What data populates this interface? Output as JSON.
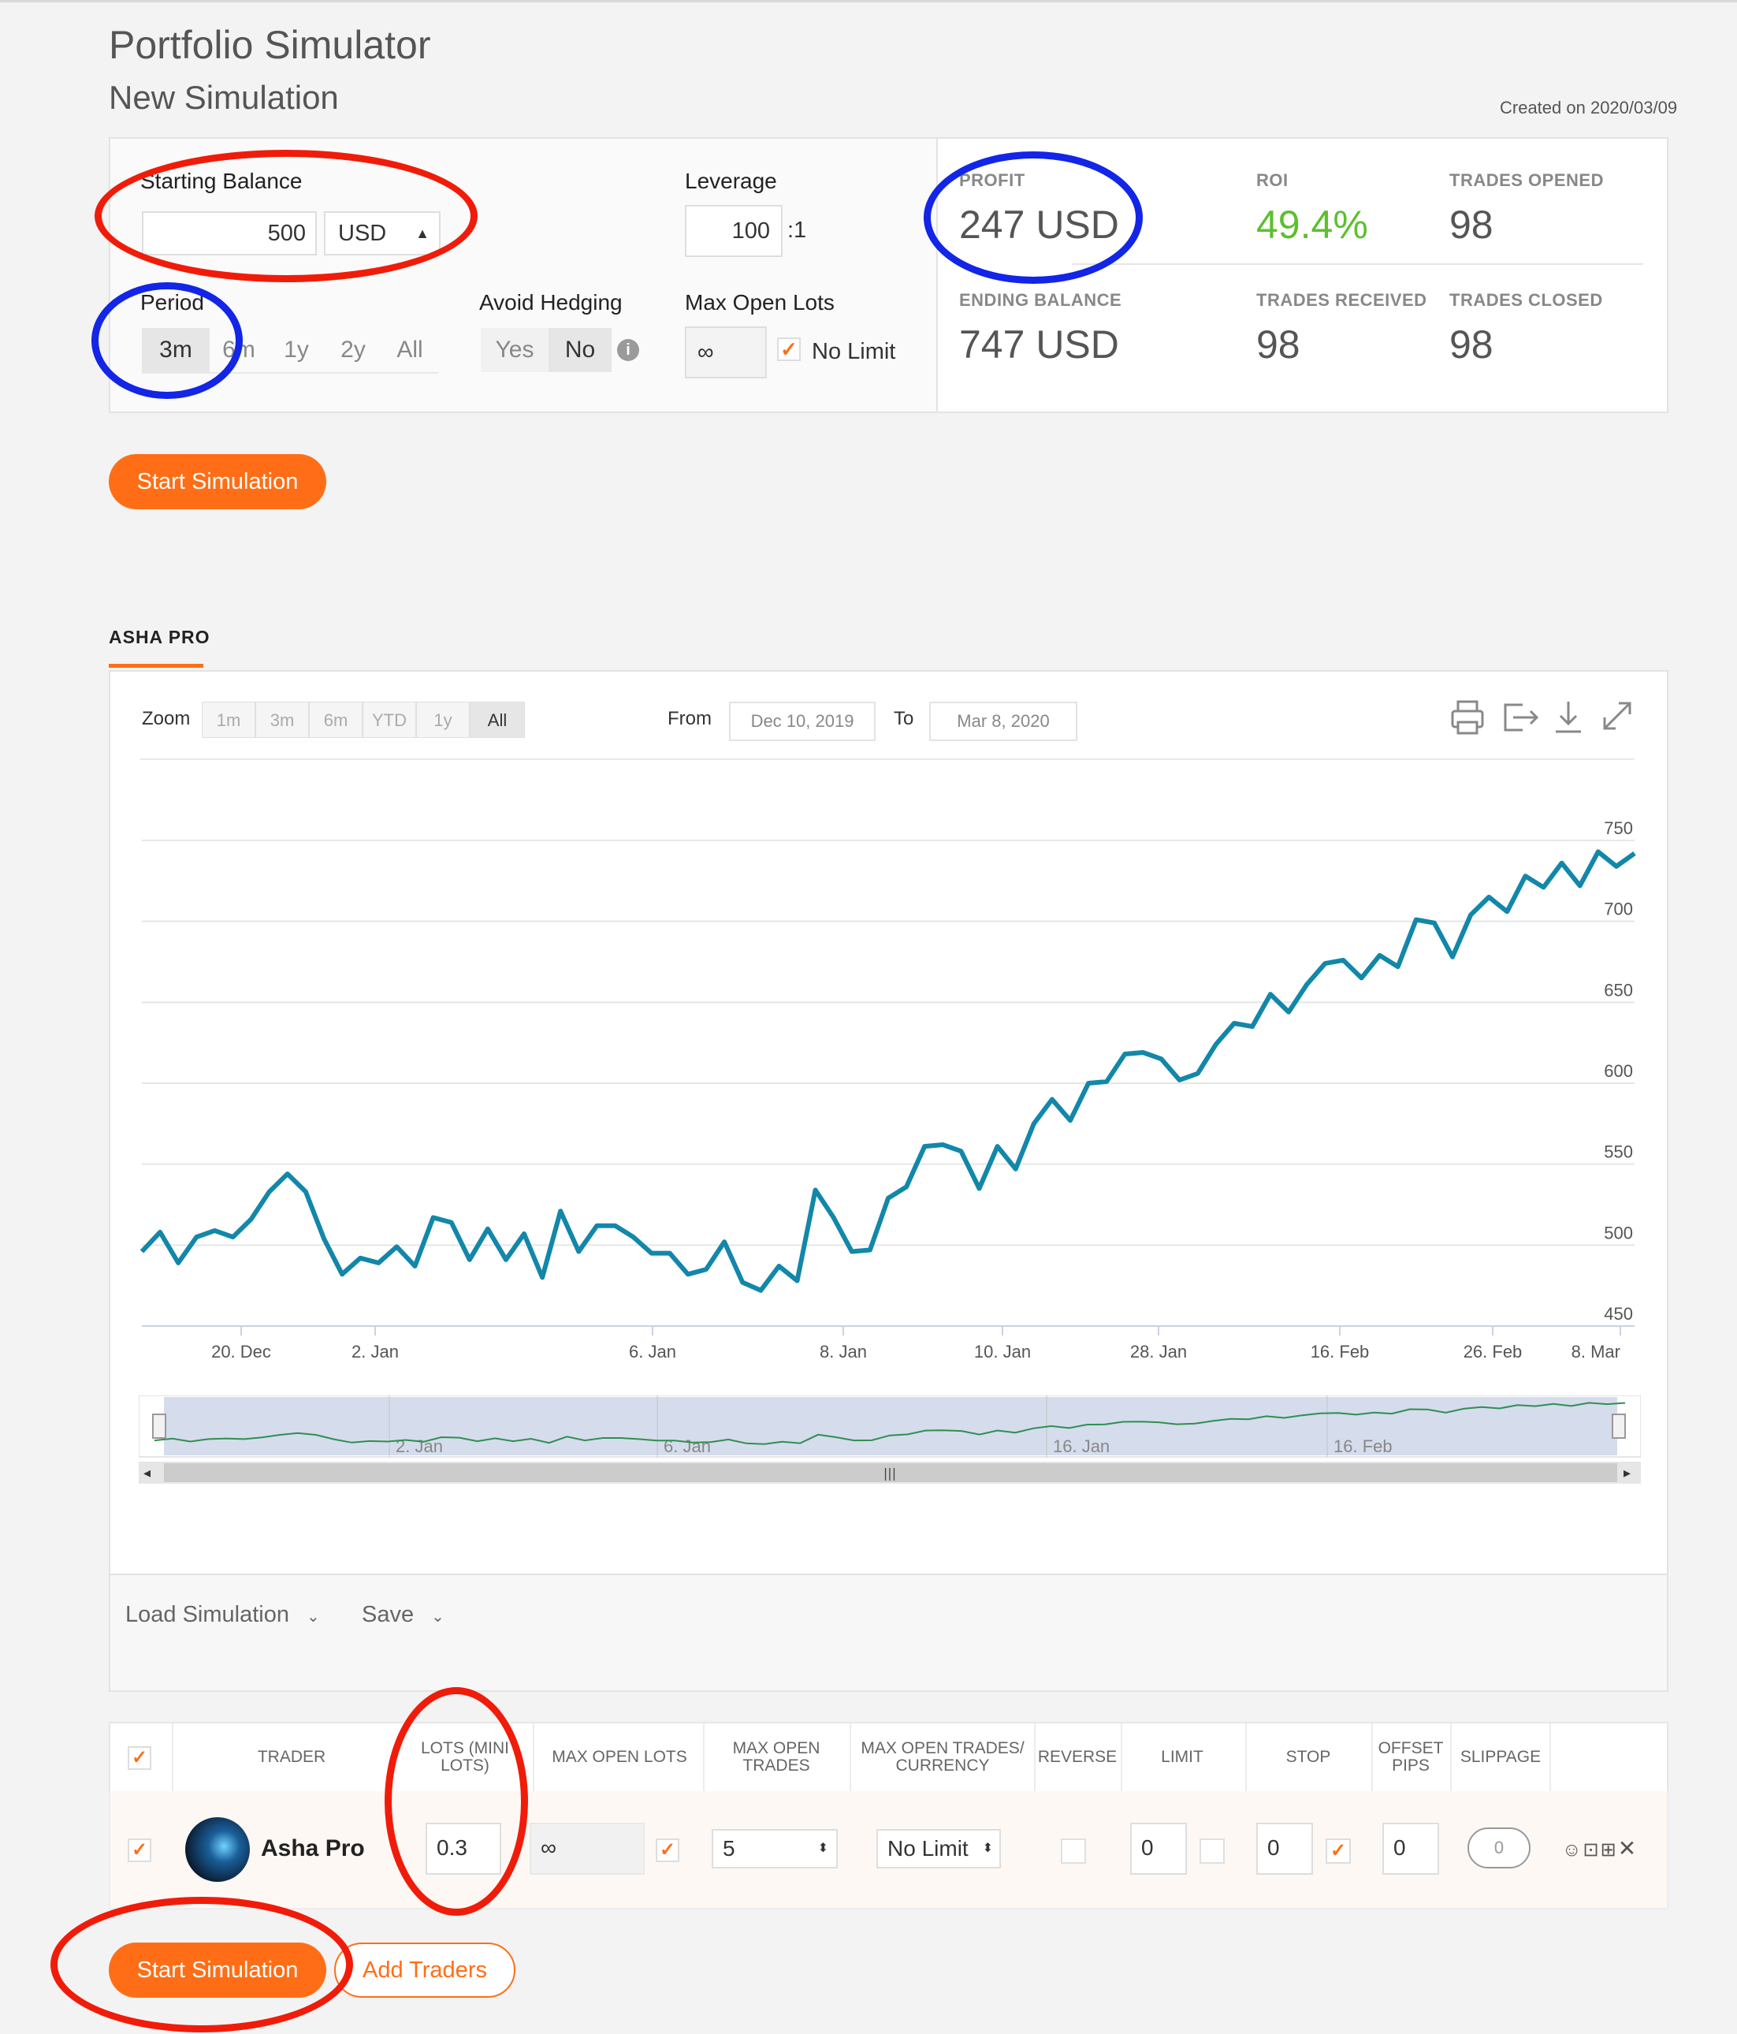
{
  "header": {
    "title": "Portfolio Simulator",
    "subtitle": "New Simulation",
    "created": "Created on 2020/03/09"
  },
  "settings": {
    "starting_balance_label": "Starting Balance",
    "starting_balance_value": "500",
    "currency": "USD",
    "leverage_label": "Leverage",
    "leverage_value": "100",
    "leverage_suffix": ":1",
    "period_label": "Period",
    "period_options": [
      "3m",
      "6m",
      "1y",
      "2y",
      "All"
    ],
    "period_selected": "3m",
    "avoid_hedging_label": "Avoid Hedging",
    "avoid_hedging_options": [
      "Yes",
      "No"
    ],
    "avoid_hedging_selected": "No",
    "max_open_lots_label": "Max Open Lots",
    "max_open_lots_value": "∞",
    "no_limit_label": "No Limit"
  },
  "stats": {
    "profit_label": "PROFIT",
    "profit_value": "247 USD",
    "roi_label": "ROI",
    "roi_value": "49.4%",
    "trades_opened_label": "TRADES OPENED",
    "trades_opened_value": "98",
    "ending_balance_label": "ENDING BALANCE",
    "ending_balance_value": "747 USD",
    "trades_received_label": "TRADES RECEIVED",
    "trades_received_value": "98",
    "trades_closed_label": "TRADES CLOSED",
    "trades_closed_value": "98"
  },
  "start_simulation_label": "Start Simulation",
  "tab": {
    "label": "ASHA PRO"
  },
  "chart_controls": {
    "zoom_label": "Zoom",
    "zoom_options": [
      "1m",
      "3m",
      "6m",
      "YTD",
      "1y",
      "All"
    ],
    "zoom_selected": "All",
    "from_label": "From",
    "from_value": "Dec 10, 2019",
    "to_label": "To",
    "to_value": "Mar 8, 2020"
  },
  "chart_data": {
    "type": "line",
    "x_ticks": [
      "20. Dec",
      "2. Jan",
      "6. Jan",
      "8. Jan",
      "10. Jan",
      "28. Jan",
      "16. Feb",
      "26. Feb",
      "8. Mar"
    ],
    "y_ticks": [
      450,
      500,
      550,
      600,
      650,
      700,
      750
    ],
    "ylim": [
      450,
      750
    ],
    "color": "#1287aa",
    "values": [
      496,
      508,
      489,
      505,
      509,
      505,
      516,
      533,
      544,
      533,
      504,
      482,
      492,
      489,
      499,
      487,
      517,
      514,
      491,
      510,
      491,
      507,
      480,
      521,
      496,
      512,
      512,
      505,
      495,
      495,
      482,
      485,
      502,
      477,
      472,
      487,
      478,
      534,
      517,
      496,
      497,
      529,
      536,
      561,
      562,
      558,
      535,
      561,
      547,
      575,
      590,
      577,
      600,
      601,
      618,
      619,
      615,
      602,
      606,
      624,
      637,
      635,
      655,
      644,
      661,
      674,
      676,
      665,
      679,
      672,
      701,
      699,
      678,
      704,
      715,
      706,
      728,
      721,
      736,
      722,
      743,
      734,
      742
    ],
    "navigator_ticks": [
      "2. Jan",
      "6. Jan",
      "16. Jan",
      "16. Feb"
    ]
  },
  "footer_actions": {
    "load_label": "Load Simulation",
    "save_label": "Save"
  },
  "table": {
    "headers": {
      "trader": "TRADER",
      "lots": [
        "LOTS (MINI",
        "LOTS)"
      ],
      "max_open_lots": "MAX OPEN LOTS",
      "max_open_trades": [
        "MAX OPEN",
        "TRADES"
      ],
      "max_open_trades_currency": [
        "MAX OPEN TRADES/",
        "CURRENCY"
      ],
      "reverse": "REVERSE",
      "limit": "LIMIT",
      "stop": "STOP",
      "offset_pips": [
        "OFFSET",
        "PIPS"
      ],
      "slippage": "SLIPPAGE"
    },
    "row": {
      "trader_name": "Asha Pro",
      "lots": "0.3",
      "max_open_lots": "∞",
      "max_open_trades": "5",
      "max_open_trades_currency": "No Limit",
      "limit": "0",
      "stop": "0",
      "offset_pips": "0",
      "slippage": "0"
    }
  },
  "add_traders_label": "Add Traders"
}
